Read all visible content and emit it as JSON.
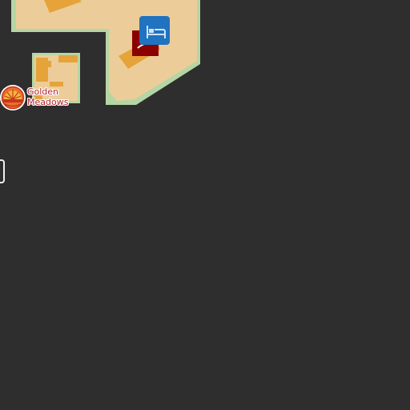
{
  "map": {
    "background_color": "#2e2e2e",
    "landuse_color": "#eccd99",
    "park_color": "#b5d6a4",
    "building_color": "#e6a33a",
    "pois": [
      {
        "name_line1": "Golden",
        "name_line2": "Meadows",
        "icon": "golden-meadows-logo-icon",
        "color": "#b3262b"
      },
      {
        "icon": "bed-icon",
        "category": "hotel",
        "color": "#1f73c0"
      }
    ]
  }
}
